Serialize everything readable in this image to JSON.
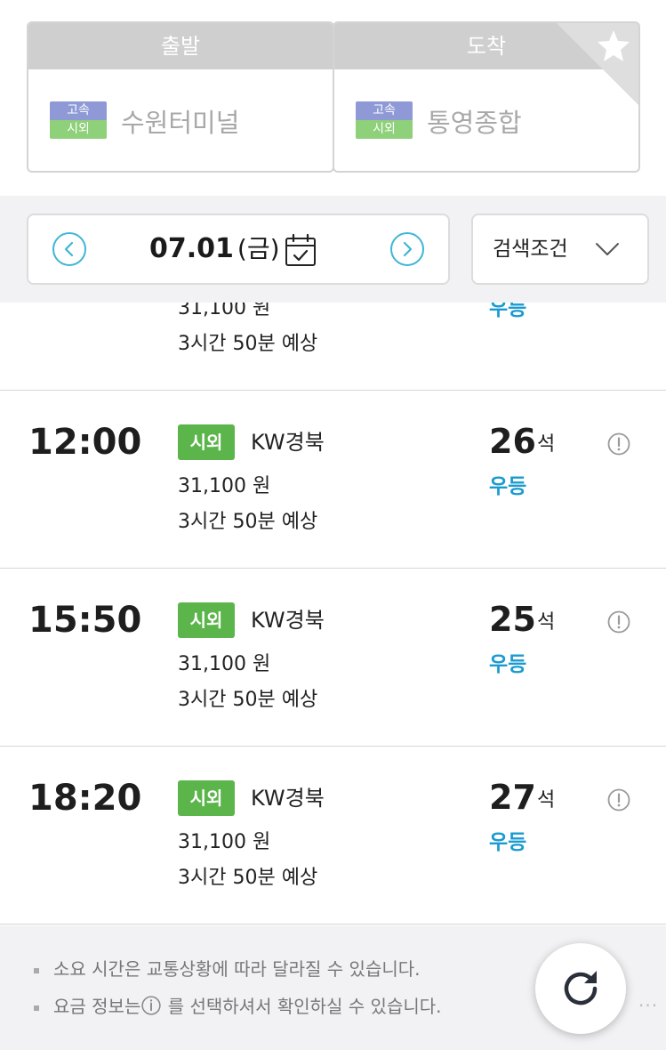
{
  "terminals": {
    "departure": {
      "header": "출발",
      "badge_top": "고속",
      "badge_bottom": "시외",
      "name": "수원터미널"
    },
    "arrival": {
      "header": "도착",
      "badge_top": "고속",
      "badge_bottom": "시외",
      "name": "통영종합"
    }
  },
  "date_bar": {
    "date": "07.01",
    "day_of_week": "(금)",
    "search_conditions_label": "검색조건"
  },
  "schedules": [
    {
      "time": "",
      "grade": "",
      "company": "",
      "fare": "31,100 원",
      "duration": "3시간 50분 예상",
      "seats": "",
      "seat_unit": "",
      "bus_class": "우등"
    },
    {
      "time": "12:00",
      "grade": "시외",
      "company": "KW경북",
      "fare": "31,100 원",
      "duration": "3시간 50분 예상",
      "seats": "26",
      "seat_unit": "석",
      "bus_class": "우등"
    },
    {
      "time": "15:50",
      "grade": "시외",
      "company": "KW경북",
      "fare": "31,100 원",
      "duration": "3시간 50분 예상",
      "seats": "25",
      "seat_unit": "석",
      "bus_class": "우등"
    },
    {
      "time": "18:20",
      "grade": "시외",
      "company": "KW경북",
      "fare": "31,100 원",
      "duration": "3시간 50분 예상",
      "seats": "27",
      "seat_unit": "석",
      "bus_class": "우등"
    }
  ],
  "footer": {
    "note1": "소요 시간은 교통상황에 따라 달라질 수 있습니다.",
    "note2_prefix": "요금 정보는",
    "note2_suffix": " 를 선택하셔서 확인하실 수 있습니다.",
    "more": "..."
  },
  "colors": {
    "header_gray": "#cfcfcf",
    "express_badge": "#8e99d6",
    "intercity_badge": "#8fd07a",
    "grade_green": "#5cb54b",
    "class_blue": "#1a9bd0",
    "nav_cyan": "#3fb6d3"
  },
  "icons": {
    "favorite": "star-icon",
    "prev": "chevron-left-circle-icon",
    "next": "chevron-right-circle-icon",
    "calendar": "calendar-icon",
    "dropdown": "chevron-down-icon",
    "info": "info-circle-icon",
    "refresh": "refresh-icon"
  }
}
